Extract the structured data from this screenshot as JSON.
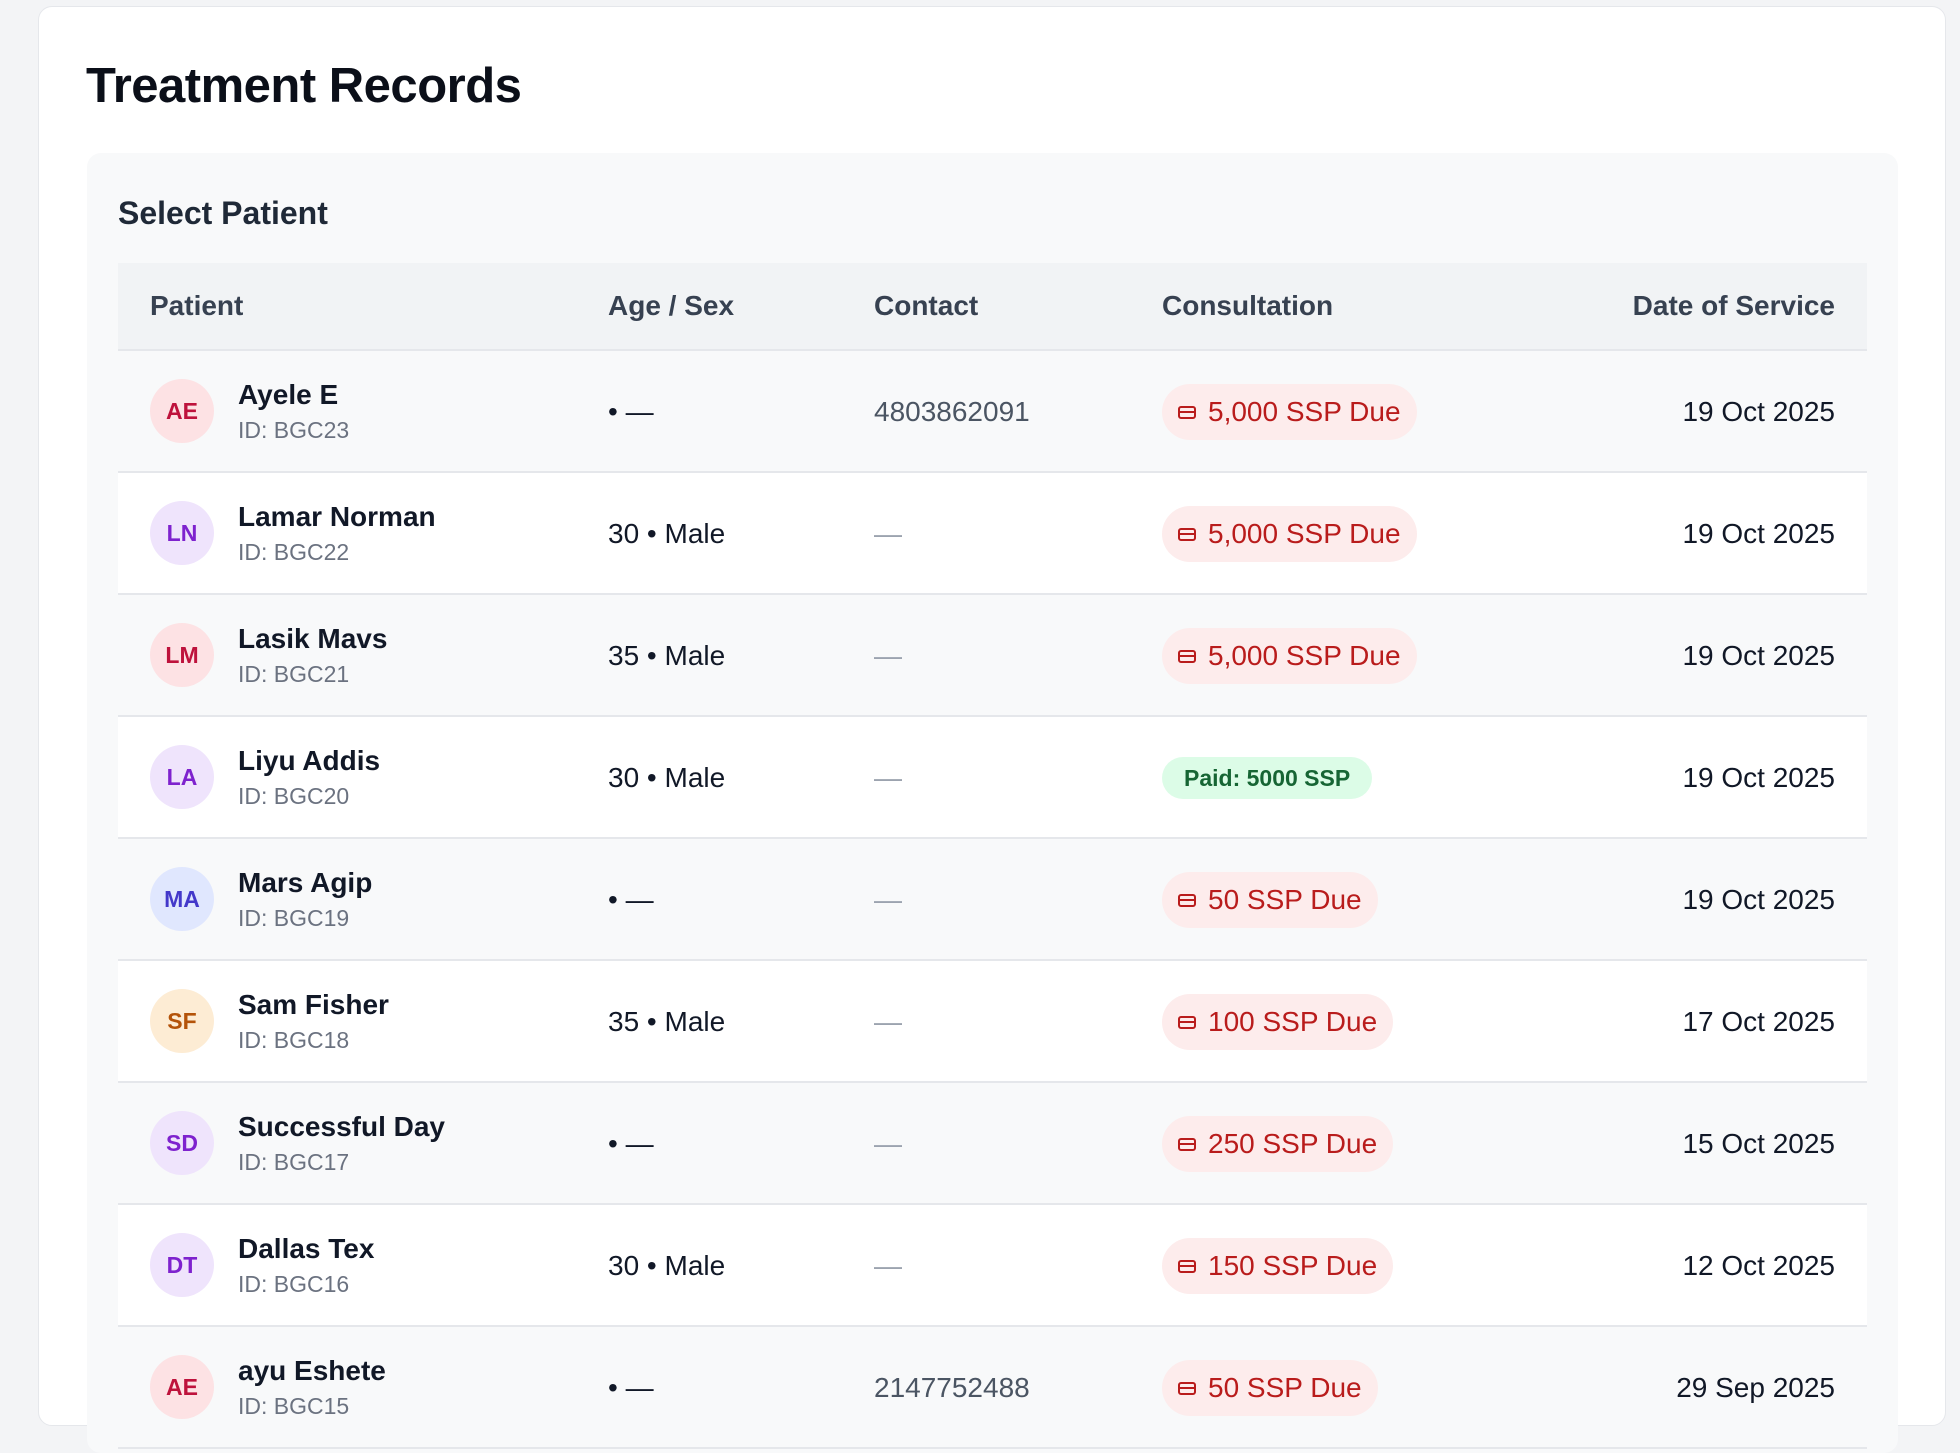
{
  "page": {
    "title": "Treatment Records"
  },
  "panel": {
    "title": "Select Patient"
  },
  "table": {
    "columns": [
      "Patient",
      "Age / Sex",
      "Contact",
      "Consultation",
      "Date of Service"
    ],
    "rows": [
      {
        "initials": "AE",
        "name": "Ayele E",
        "id": "ID: BGC23",
        "age_sex": "• —",
        "contact": "4803862091",
        "consultation": "5,000 SSP Due",
        "status": "due",
        "date": "19 Oct 2025",
        "avatar_bg": "#fde2e4",
        "avatar_fg": "#be123c"
      },
      {
        "initials": "LN",
        "name": "Lamar Norman",
        "id": "ID: BGC22",
        "age_sex": "30 • Male",
        "contact": "—",
        "consultation": "5,000 SSP Due",
        "status": "due",
        "date": "19 Oct 2025",
        "avatar_bg": "#efe4fc",
        "avatar_fg": "#7e22ce"
      },
      {
        "initials": "LM",
        "name": "Lasik Mavs",
        "id": "ID: BGC21",
        "age_sex": "35 • Male",
        "contact": "—",
        "consultation": "5,000 SSP Due",
        "status": "due",
        "date": "19 Oct 2025",
        "avatar_bg": "#fde2e4",
        "avatar_fg": "#be123c"
      },
      {
        "initials": "LA",
        "name": "Liyu Addis",
        "id": "ID: BGC20",
        "age_sex": "30 • Male",
        "contact": "—",
        "consultation": "Paid: 5000 SSP",
        "status": "paid",
        "date": "19 Oct 2025",
        "avatar_bg": "#efe4fc",
        "avatar_fg": "#7e22ce"
      },
      {
        "initials": "MA",
        "name": "Mars Agip",
        "id": "ID: BGC19",
        "age_sex": "• —",
        "contact": "—",
        "consultation": "50 SSP Due",
        "status": "due",
        "date": "19 Oct 2025",
        "avatar_bg": "#e0e7fe",
        "avatar_fg": "#4338ca"
      },
      {
        "initials": "SF",
        "name": "Sam Fisher",
        "id": "ID: BGC18",
        "age_sex": "35 • Male",
        "contact": "—",
        "consultation": "100 SSP Due",
        "status": "due",
        "date": "17 Oct 2025",
        "avatar_bg": "#fdecd4",
        "avatar_fg": "#b45309"
      },
      {
        "initials": "SD",
        "name": "Successful Day",
        "id": "ID: BGC17",
        "age_sex": "• —",
        "contact": "—",
        "consultation": "250 SSP Due",
        "status": "due",
        "date": "15 Oct 2025",
        "avatar_bg": "#efe4fc",
        "avatar_fg": "#7e22ce"
      },
      {
        "initials": "DT",
        "name": "Dallas Tex",
        "id": "ID: BGC16",
        "age_sex": "30 • Male",
        "contact": "—",
        "consultation": "150 SSP Due",
        "status": "due",
        "date": "12 Oct 2025",
        "avatar_bg": "#efe4fc",
        "avatar_fg": "#7e22ce"
      },
      {
        "initials": "AE",
        "name": "ayu Eshete",
        "id": "ID: BGC15",
        "age_sex": "• —",
        "contact": "2147752488",
        "consultation": "50 SSP Due",
        "status": "due",
        "date": "29 Sep 2025",
        "avatar_bg": "#fde2e4",
        "avatar_fg": "#be123c"
      }
    ]
  }
}
